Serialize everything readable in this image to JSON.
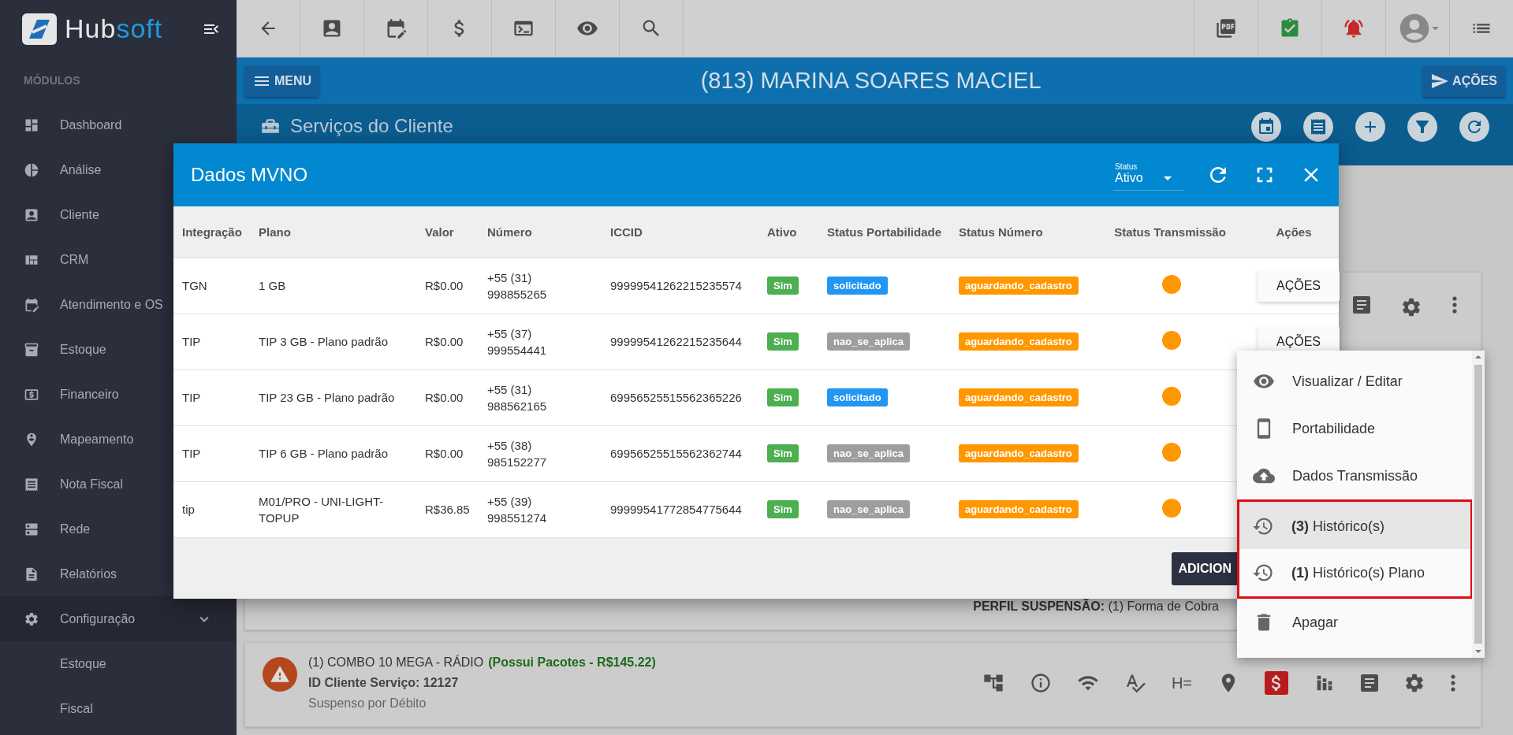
{
  "brand": {
    "lead": "Hub",
    "tail": "soft"
  },
  "sidebar": {
    "section": "MÓDULOS",
    "items": [
      {
        "label": "Dashboard"
      },
      {
        "label": "Análise"
      },
      {
        "label": "Cliente"
      },
      {
        "label": "CRM"
      },
      {
        "label": "Atendimento e OS"
      },
      {
        "label": "Estoque"
      },
      {
        "label": "Financeiro"
      },
      {
        "label": "Mapeamento"
      },
      {
        "label": "Nota Fiscal"
      },
      {
        "label": "Rede"
      },
      {
        "label": "Relatórios"
      },
      {
        "label": "Configuração",
        "expanded": true,
        "children": [
          {
            "label": "Estoque"
          },
          {
            "label": "Fiscal"
          }
        ]
      }
    ]
  },
  "header": {
    "menu_button": "MENU",
    "title": "(813) MARINA SOARES MACIEL",
    "actions_button": "AÇÕES"
  },
  "section_title": "Serviços do Cliente",
  "modal": {
    "title": "Dados MVNO",
    "status_filter": {
      "label": "Status",
      "value": "Ativo"
    },
    "columns": [
      "Integração",
      "Plano",
      "Valor",
      "Número",
      "ICCID",
      "Ativo",
      "Status Portabilidade",
      "Status Número",
      "Status Transmissão",
      "Ações"
    ],
    "rows": [
      {
        "integracao": "TGN",
        "plano": "1 GB",
        "valor": "R$0.00",
        "numero": "+55 (31) 998855265",
        "iccid": "99999541262215235574",
        "ativo": {
          "text": "Sim",
          "color": "#4caf50"
        },
        "portabilidade": {
          "text": "solicitado",
          "color": "#2196f3"
        },
        "status_numero": {
          "text": "aguardando_cadastro",
          "color": "#ff9800"
        },
        "transmissao": {
          "color": "#ff9800"
        },
        "acoes": "AÇÕES"
      },
      {
        "integracao": "TIP",
        "plano": "TIP 3 GB - Plano padrão",
        "valor": "R$0.00",
        "numero": "+55 (37) 999554441",
        "iccid": "99999541262215235644",
        "ativo": {
          "text": "Sim",
          "color": "#4caf50"
        },
        "portabilidade": {
          "text": "nao_se_aplica",
          "color": "#9e9e9e"
        },
        "status_numero": {
          "text": "aguardando_cadastro",
          "color": "#ff9800"
        },
        "transmissao": {
          "color": "#ff9800"
        },
        "acoes": "AÇÕES"
      },
      {
        "integracao": "TIP",
        "plano": "TIP 23 GB - Plano padrão",
        "valor": "R$0.00",
        "numero": "+55 (31) 988562165",
        "iccid": "69956525515562365226",
        "ativo": {
          "text": "Sim",
          "color": "#4caf50"
        },
        "portabilidade": {
          "text": "solicitado",
          "color": "#2196f3"
        },
        "status_numero": {
          "text": "aguardando_cadastro",
          "color": "#ff9800"
        },
        "transmissao": {
          "color": "#ff9800"
        }
      },
      {
        "integracao": "TIP",
        "plano": "TIP 6 GB - Plano padrão",
        "valor": "R$0.00",
        "numero": "+55 (38) 985152277",
        "iccid": "69956525515562362744",
        "ativo": {
          "text": "Sim",
          "color": "#4caf50"
        },
        "portabilidade": {
          "text": "nao_se_aplica",
          "color": "#9e9e9e"
        },
        "status_numero": {
          "text": "aguardando_cadastro",
          "color": "#ff9800"
        },
        "transmissao": {
          "color": "#ff9800"
        }
      },
      {
        "integracao": "tip",
        "plano": "M01/PRO - UNI-LIGHT-TOPUP",
        "valor": "R$36.85",
        "numero": "+55 (39) 998551274",
        "iccid": "99999541772854775644",
        "ativo": {
          "text": "Sim",
          "color": "#4caf50"
        },
        "portabilidade": {
          "text": "nao_se_aplica",
          "color": "#9e9e9e"
        },
        "status_numero": {
          "text": "aguardando_cadastro",
          "color": "#ff9800"
        },
        "transmissao": {
          "color": "#ff9800"
        }
      }
    ],
    "footer_button": "ADICION"
  },
  "actions_menu": {
    "items": [
      {
        "label": "Visualizar / Editar",
        "hovered": false,
        "framed": false,
        "divider_before": false
      },
      {
        "label": "Portabilidade",
        "hovered": false,
        "framed": false,
        "divider_before": false
      },
      {
        "label": "Dados Transmissão",
        "hovered": false,
        "framed": false,
        "divider_before": false
      },
      {
        "label": "**(3)** Histórico(s)",
        "hovered": true,
        "framed": true,
        "divider_before": true
      },
      {
        "label": "**(1)** Histórico(s) Plano",
        "hovered": false,
        "framed": true,
        "divider_before": false
      },
      {
        "label": "Apagar",
        "hovered": false,
        "framed": false,
        "divider_before": false
      }
    ]
  },
  "service_card": {
    "suspension": "**PERFIL SUSPENSÃO:** (1) Forma de Cobra"
  },
  "service": {
    "title": "(1) COMBO 10 MEGA - RÁDIO",
    "packages": "(Possui Pacotes - R$145.22)",
    "id": "ID Cliente Serviço: 12127",
    "status": "Suspenso por Débito",
    "tool_text": "H="
  }
}
